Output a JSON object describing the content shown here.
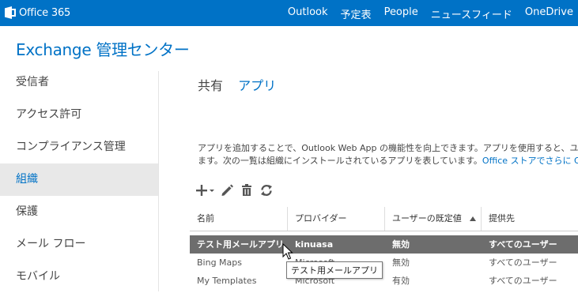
{
  "topbar": {
    "brand": "Office 365",
    "nav": [
      "Outlook",
      "予定表",
      "People",
      "ニュースフィード",
      "OneDrive"
    ],
    "color": "#0072c6"
  },
  "header": {
    "title": "Exchange 管理センター"
  },
  "sidebar": {
    "items": [
      {
        "label": "受信者"
      },
      {
        "label": "アクセス許可"
      },
      {
        "label": "コンプライアンス管理"
      },
      {
        "label": "組織",
        "active": true
      },
      {
        "label": "保護"
      },
      {
        "label": "メール フロー"
      },
      {
        "label": "モバイル"
      }
    ]
  },
  "tabs": [
    {
      "label": "共有"
    },
    {
      "label": "アプリ",
      "active": true
    }
  ],
  "description": {
    "line1": "アプリを追加することで、Outlook Web App の機能性を向上できます。アプリを使用すると、ユーザーは",
    "line2": "ます。次の一覧は組織にインストールされているアプリを表しています。",
    "link": "Office ストアでさらに Outlook 用"
  },
  "toolbar": {
    "icons": [
      "add-icon",
      "edit-icon",
      "delete-icon",
      "refresh-icon"
    ]
  },
  "table": {
    "columns": [
      "名前",
      "プロバイダー",
      "ユーザーの既定値",
      "提供先"
    ],
    "sorted_column": 2,
    "rows": [
      {
        "name": "テスト用メールアプリ",
        "provider": "kinuasa",
        "default": "無効",
        "available": "すべてのユーザー",
        "selected": true
      },
      {
        "name": "Bing Maps",
        "provider": "Microsoft",
        "default": "無効",
        "available": "すべてのユーザー"
      },
      {
        "name": "My Templates",
        "provider": "Microsoft",
        "default": "有効",
        "available": "すべてのユーザー"
      }
    ]
  },
  "tooltip": {
    "text": "テスト用メールアプリ"
  }
}
